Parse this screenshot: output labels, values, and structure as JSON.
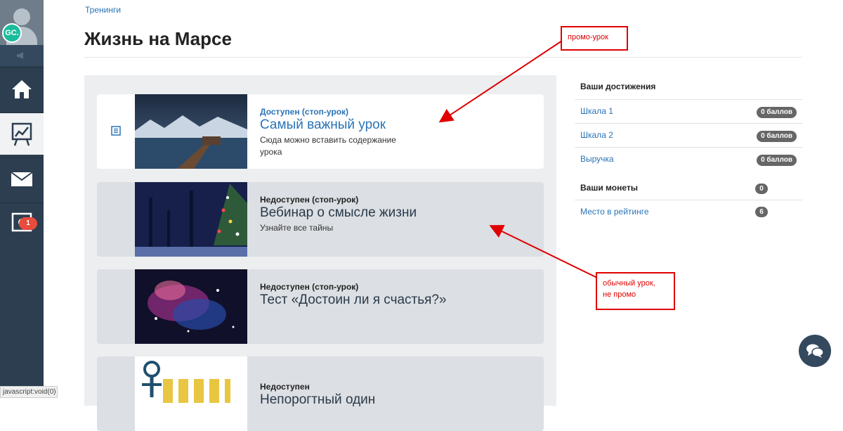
{
  "sidebar": {
    "user_initials": "GC.",
    "notifications_count": "1"
  },
  "status_bar": {
    "text": "javascript:void(0)"
  },
  "breadcrumb": "Тренинги",
  "page": {
    "title": "Жизнь на Марсе"
  },
  "lessons": [
    {
      "status": "Доступен (стоп-урок)",
      "title": "Самый важный урок",
      "description": "Сюда можно вставить содержание урока",
      "available": true
    },
    {
      "status": "Недоступен (стоп-урок)",
      "title": "Вебинар о смысле жизни",
      "description": "Узнайте все тайны",
      "available": false
    },
    {
      "status": "Недоступен (стоп-урок)",
      "title": "Тест «Достоин ли я счастья?»",
      "description": "",
      "available": false
    },
    {
      "status": "Недоступен",
      "title": "Непорогтный один",
      "description": "",
      "available": false
    }
  ],
  "achievements": {
    "title": "Ваши достижения",
    "items": [
      {
        "label": "Шкала 1",
        "value": "0 баллов"
      },
      {
        "label": "Шкала 2",
        "value": "0 баллов"
      },
      {
        "label": "Выручка",
        "value": "0 баллов"
      }
    ]
  },
  "coins": {
    "title": "Ваши монеты",
    "value": "0"
  },
  "rating": {
    "label": "Место в рейтинге",
    "value": "6"
  },
  "annotations": {
    "promo": "промо-урок",
    "regular_line1": "обычный урок,",
    "regular_line2": "не промо",
    "color": "#e00000"
  },
  "colors": {
    "sidebar": "#2c3e50",
    "link": "#2a73b6",
    "panel": "#eceef0",
    "badge": "#666666",
    "notification": "#e74c3c"
  }
}
